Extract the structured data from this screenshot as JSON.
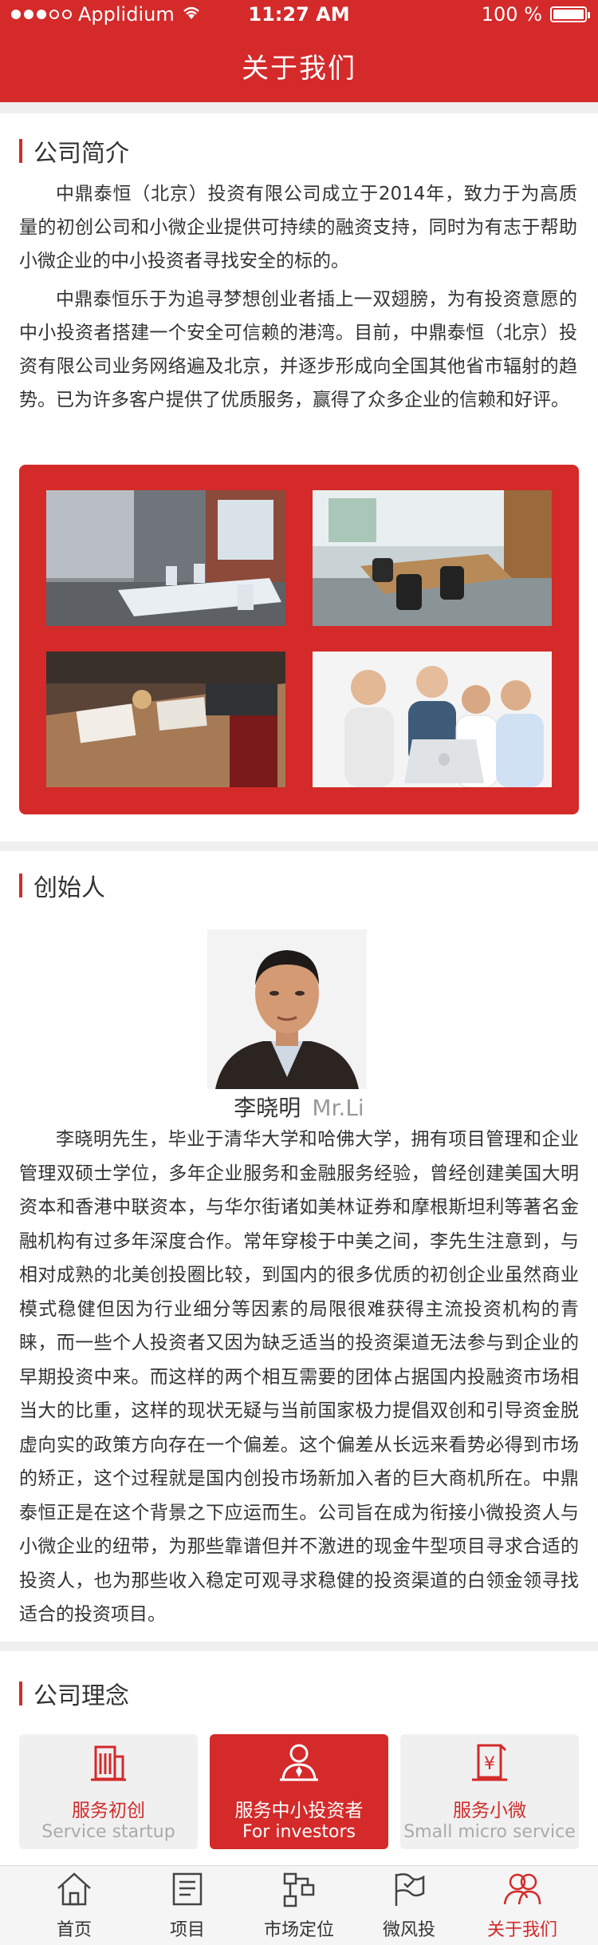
{
  "status_bar": {
    "carrier": "Applidium",
    "time": "11:27 AM",
    "battery": "100 %",
    "signal_bars_filled": 3,
    "signal_bars_total": 5
  },
  "header": {
    "title": "关于我们"
  },
  "intro": {
    "heading": "公司简介",
    "paragraph1": "中鼎泰恒（北京）投资有限公司成立于2014年，致力于为高质量的初创公司和小微企业提供可持续的融资支持，同时为有志于帮助小微企业的中小投资者寻找安全的标的。",
    "paragraph2": "中鼎泰恒乐于为追寻梦想创业者插上一双翅膀，为有投资意愿的中小投资者搭建一个安全可信赖的港湾。目前，中鼎泰恒（北京）投资有限公司业务网络遍及北京，并逐步形成向全国其他省市辐射的趋势。已为许多客户提供了优质服务，赢得了众多企业的信赖和好评。"
  },
  "founder": {
    "heading": "创始人",
    "name_cn": "李晓明",
    "name_en": "Mr.Li",
    "bio": "李晓明先生，毕业于清华大学和哈佛大学，拥有项目管理和企业管理双硕士学位，多年企业服务和金融服务经验，曾经创建美国大明资本和香港中联资本，与华尔街诸如美林证券和摩根斯坦利等著名金融机构有过多年深度合作。常年穿梭于中美之间，李先生注意到，与相对成熟的北美创投圈比较，到国内的很多优质的初创企业虽然商业模式稳健但因为行业细分等因素的局限很难获得主流投资机构的青睐，而一些个人投资者又因为缺乏适当的投资渠道无法参与到企业的早期投资中来。而这样的两个相互需要的团体占据国内投融资市场相当大的比重，这样的现状无疑与当前国家极力提倡双创和引导资金脱虚向实的政策方向存在一个偏差。这个偏差从长远来看势必得到市场的矫正，这个过程就是国内创投市场新加入者的巨大商机所在。中鼎泰恒正是在这个背景之下应运而生。公司旨在成为衔接小微投资人与小微企业的纽带，为那些靠谱但并不激进的现金牛型项目寻求合适的投资人，也为那些收入稳定可观寻求稳健的投资渠道的白领金领寻找适合的投资项目。"
  },
  "philosophy": {
    "heading": "公司理念",
    "cards": [
      {
        "cn": "服务初创",
        "en": "Service startup",
        "icon": "building-icon",
        "active": false
      },
      {
        "cn": "服务中小投资者",
        "en": "For investors",
        "icon": "investor-icon",
        "active": true
      },
      {
        "cn": "服务小微",
        "en": "Small micro service",
        "icon": "document-yuan-icon",
        "active": false
      }
    ]
  },
  "tabbar": {
    "items": [
      {
        "label": "首页",
        "icon": "home-icon",
        "active": false
      },
      {
        "label": "项目",
        "icon": "document-list-icon",
        "active": false
      },
      {
        "label": "市场定位",
        "icon": "network-icon",
        "active": false
      },
      {
        "label": "微风投",
        "icon": "flag-icon",
        "active": false
      },
      {
        "label": "关于我们",
        "icon": "people-icon",
        "active": true
      }
    ]
  },
  "colors": {
    "brand": "#d42a2a",
    "text": "#333333",
    "muted": "#999999",
    "background": "#f0f0f0"
  }
}
